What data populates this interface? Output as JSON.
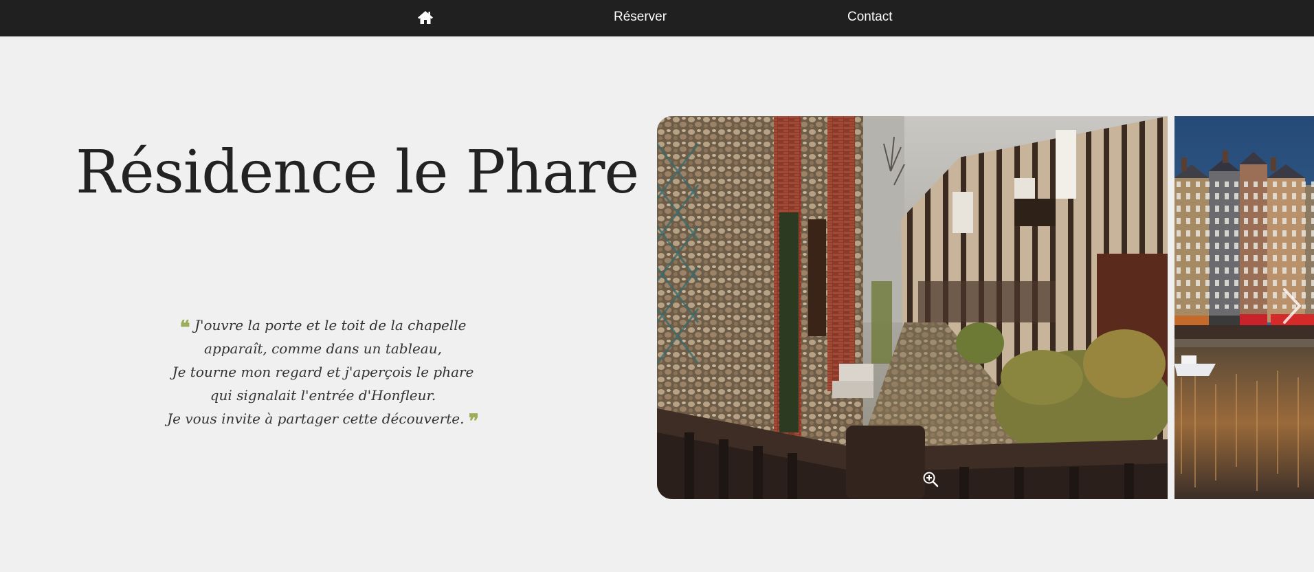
{
  "nav": {
    "home_icon": "home-icon",
    "items": [
      {
        "label": "Réserver"
      },
      {
        "label": "Contact"
      }
    ]
  },
  "hero": {
    "title": "Résidence le Phare"
  },
  "quote": {
    "lines": [
      "J'ouvre la porte et le toit de la chapelle",
      "apparaît, comme dans un tableau,",
      "Je tourne mon regard et j'aperçois le phare",
      "qui signalait l'entrée d'Honfleur.",
      "Je vous invite à partager cette découverte."
    ],
    "open_mark": "❝",
    "close_mark": "❞",
    "accent_color": "#9cae5b"
  },
  "gallery": {
    "zoom_icon": "zoom-in-icon",
    "next_icon": "chevron-right-icon"
  },
  "colors": {
    "nav_background": "#202020",
    "page_background": "#f0f0f0",
    "title": "#222222"
  }
}
